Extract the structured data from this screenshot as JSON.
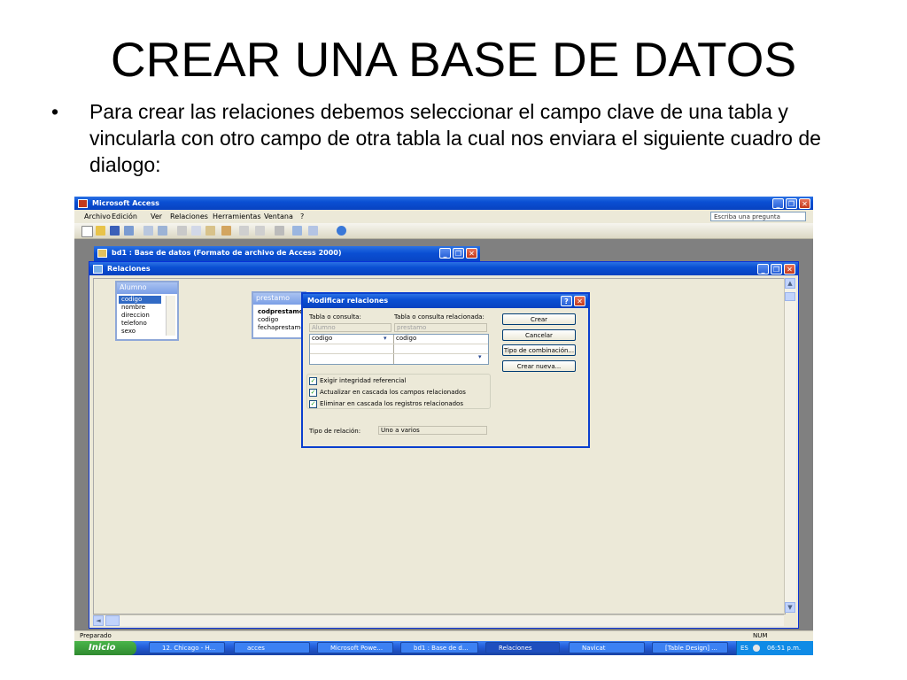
{
  "slide": {
    "title": "CREAR UNA BASE DE DATOS",
    "bullet": "•",
    "text": "Para crear las relaciones debemos seleccionar el campo clave de una tabla y vincularla con otro campo de otra tabla la cual nos enviara el siguiente cuadro de dialogo:"
  },
  "app": {
    "title": "Microsoft Access",
    "menu": [
      "Archivo",
      "Edición",
      "Ver",
      "Relaciones",
      "Herramientas",
      "Ventana",
      "?"
    ],
    "help_placeholder": "Escriba una pregunta",
    "db_window_title": "bd1 : Base de datos (Formato de archivo de Access 2000)",
    "relations_window_title": "Relaciones"
  },
  "tables": {
    "alumno": {
      "name": "Alumno",
      "fields": [
        "codigo",
        "nombre",
        "direccion",
        "telefono",
        "sexo"
      ],
      "selected": "codigo"
    },
    "prestamo": {
      "name": "prestamo",
      "fields": [
        "codprestamo",
        "codigo",
        "fechaprestamo"
      ]
    }
  },
  "dialog": {
    "title": "Modificar relaciones",
    "table_label": "Tabla o consulta:",
    "related_label": "Tabla o consulta relacionada:",
    "table_value": "Alumno",
    "related_value": "prestamo",
    "field_left": "codigo",
    "field_right": "codigo",
    "buttons": [
      "Crear",
      "Cancelar",
      "Tipo de combinación...",
      "Crear nueva..."
    ],
    "checks": [
      {
        "label": "Exigir integridad referencial",
        "checked": true
      },
      {
        "label": "Actualizar en cascada los campos relacionados",
        "checked": true
      },
      {
        "label": "Eliminar en cascada los registros relacionados",
        "checked": true
      }
    ],
    "relation_type_label": "Tipo de relación:",
    "relation_type_value": "Uno a varios"
  },
  "status": {
    "left": "Preparado",
    "right": "NUM"
  },
  "taskbar": {
    "start": "Inicio",
    "tasks": [
      "12. Chicago - H...",
      "acces",
      "Microsoft Powe...",
      "bd1 : Base de d...",
      "Relaciones",
      "Navicat",
      "[Table Design] ..."
    ],
    "lang": "ES",
    "clock": "06:51 p.m."
  },
  "colors": {
    "xp_blue": "#0a4fd3",
    "window_bg": "#ece9d8",
    "mdi_bg": "#808080",
    "start_green": "#2f8a2f"
  }
}
